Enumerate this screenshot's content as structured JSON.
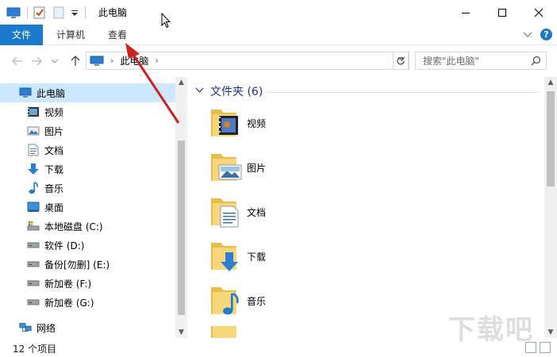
{
  "window": {
    "title": "此电脑",
    "buttons": {
      "minimize": "—",
      "maximize": "☐",
      "close": "✕"
    }
  },
  "ribbon": {
    "tabs": [
      {
        "label": "文件",
        "active": true
      },
      {
        "label": "计算机",
        "active": false
      },
      {
        "label": "查看",
        "active": false
      }
    ],
    "help": "?"
  },
  "address": {
    "crumb": "此电脑",
    "search_placeholder": "搜索\"此电脑\""
  },
  "nav": {
    "items": [
      {
        "label": "此电脑",
        "icon": "pc-icon",
        "selected": true
      },
      {
        "label": "视频",
        "icon": "video-icon"
      },
      {
        "label": "图片",
        "icon": "pictures-icon"
      },
      {
        "label": "文档",
        "icon": "documents-icon"
      },
      {
        "label": "下载",
        "icon": "download-icon"
      },
      {
        "label": "音乐",
        "icon": "music-icon"
      },
      {
        "label": "桌面",
        "icon": "desktop-icon"
      },
      {
        "label": "本地磁盘 (C:)",
        "icon": "system-drive-icon"
      },
      {
        "label": "软件 (D:)",
        "icon": "drive-icon"
      },
      {
        "label": "备份[勿删] (E:)",
        "icon": "drive-icon"
      },
      {
        "label": "新加卷 (F:)",
        "icon": "drive-icon"
      },
      {
        "label": "新加卷 (G:)",
        "icon": "drive-icon"
      },
      {
        "label": "网络",
        "icon": "network-icon"
      }
    ]
  },
  "content": {
    "group_title": "文件夹 (6)",
    "folders": [
      {
        "label": "视频",
        "icon": "video-folder-icon"
      },
      {
        "label": "图片",
        "icon": "pictures-folder-icon"
      },
      {
        "label": "文档",
        "icon": "documents-folder-icon"
      },
      {
        "label": "下载",
        "icon": "download-folder-icon"
      },
      {
        "label": "音乐",
        "icon": "music-folder-icon"
      }
    ]
  },
  "status": {
    "count": "12 个项目"
  },
  "watermark": "下载吧",
  "colors": {
    "accent": "#1979ca",
    "selection": "#cce8ff",
    "group_title": "#1e3287",
    "arrow": "#d0221c"
  }
}
